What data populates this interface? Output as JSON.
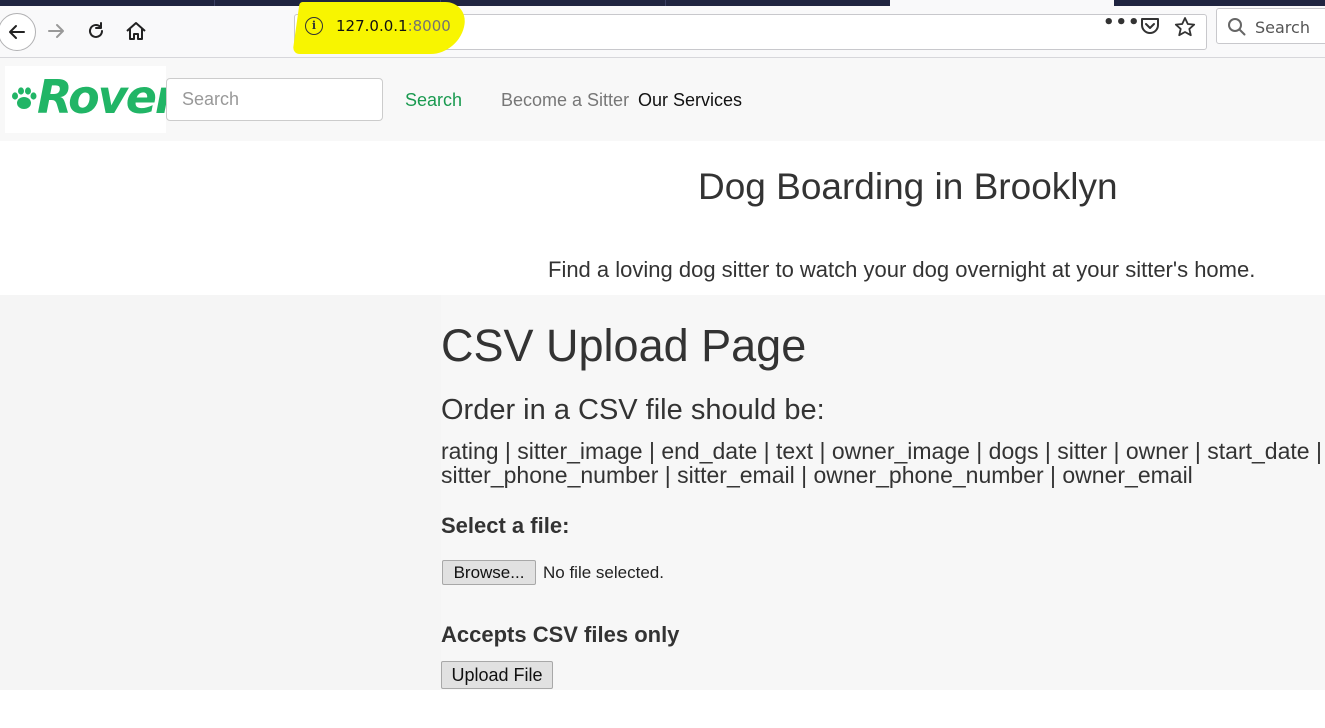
{
  "browser": {
    "url_host": "127.0.0.1",
    "url_port": ":8000",
    "search_placeholder": "Search",
    "highlight_color": "#f8f500"
  },
  "site_nav": {
    "logo_text": "Rover",
    "brand_color": "#21b566",
    "search_placeholder": "Search",
    "search_link": "Search",
    "links": [
      "Become a Sitter",
      "Our Services"
    ]
  },
  "hero": {
    "title": "Dog Boarding in Brooklyn",
    "subtitle": "Find a loving dog sitter to watch your dog overnight at your sitter's home."
  },
  "main": {
    "page_title": "CSV Upload Page",
    "order_heading": "Order in a CSV file should be:",
    "fields_text": "rating | sitter_image | end_date | text | owner_image | dogs | sitter | owner | start_date | sitter_phone_number | sitter_email | owner_phone_number | owner_email",
    "select_label": "Select a file:",
    "browse_label": "Browse...",
    "file_status": "No file selected.",
    "accepts_label": "Accepts CSV files only",
    "upload_label": "Upload File"
  }
}
